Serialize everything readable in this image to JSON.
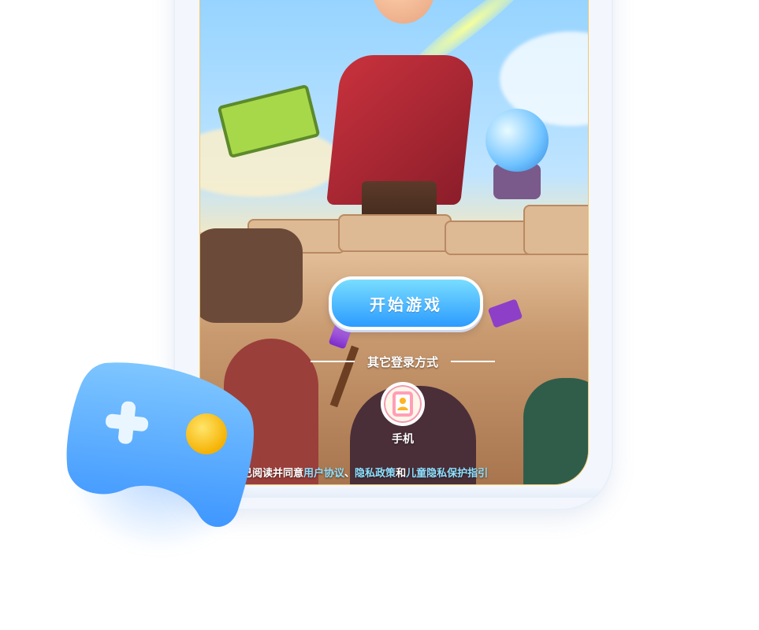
{
  "screen": {
    "start_button_label": "开始游戏",
    "other_login": {
      "label": "其它登录方式",
      "methods": [
        {
          "label": "手机",
          "icon": "phone-icon"
        }
      ]
    },
    "agreement": {
      "prefix": "我已阅读并同意",
      "user_agreement": "用户协议",
      "separator": "、",
      "privacy_policy": "隐私政策",
      "and": "和",
      "child_privacy": "儿童隐私保护指引"
    }
  },
  "colors": {
    "button_gradient_top": "#79ddff",
    "button_gradient_bottom": "#2c9bff",
    "link": "#8fe0ff",
    "gamepad_blue": "#4aa3ff",
    "gamepad_yellow": "#ffc21a"
  },
  "icons": [
    "gamepad-icon",
    "phone-icon"
  ]
}
